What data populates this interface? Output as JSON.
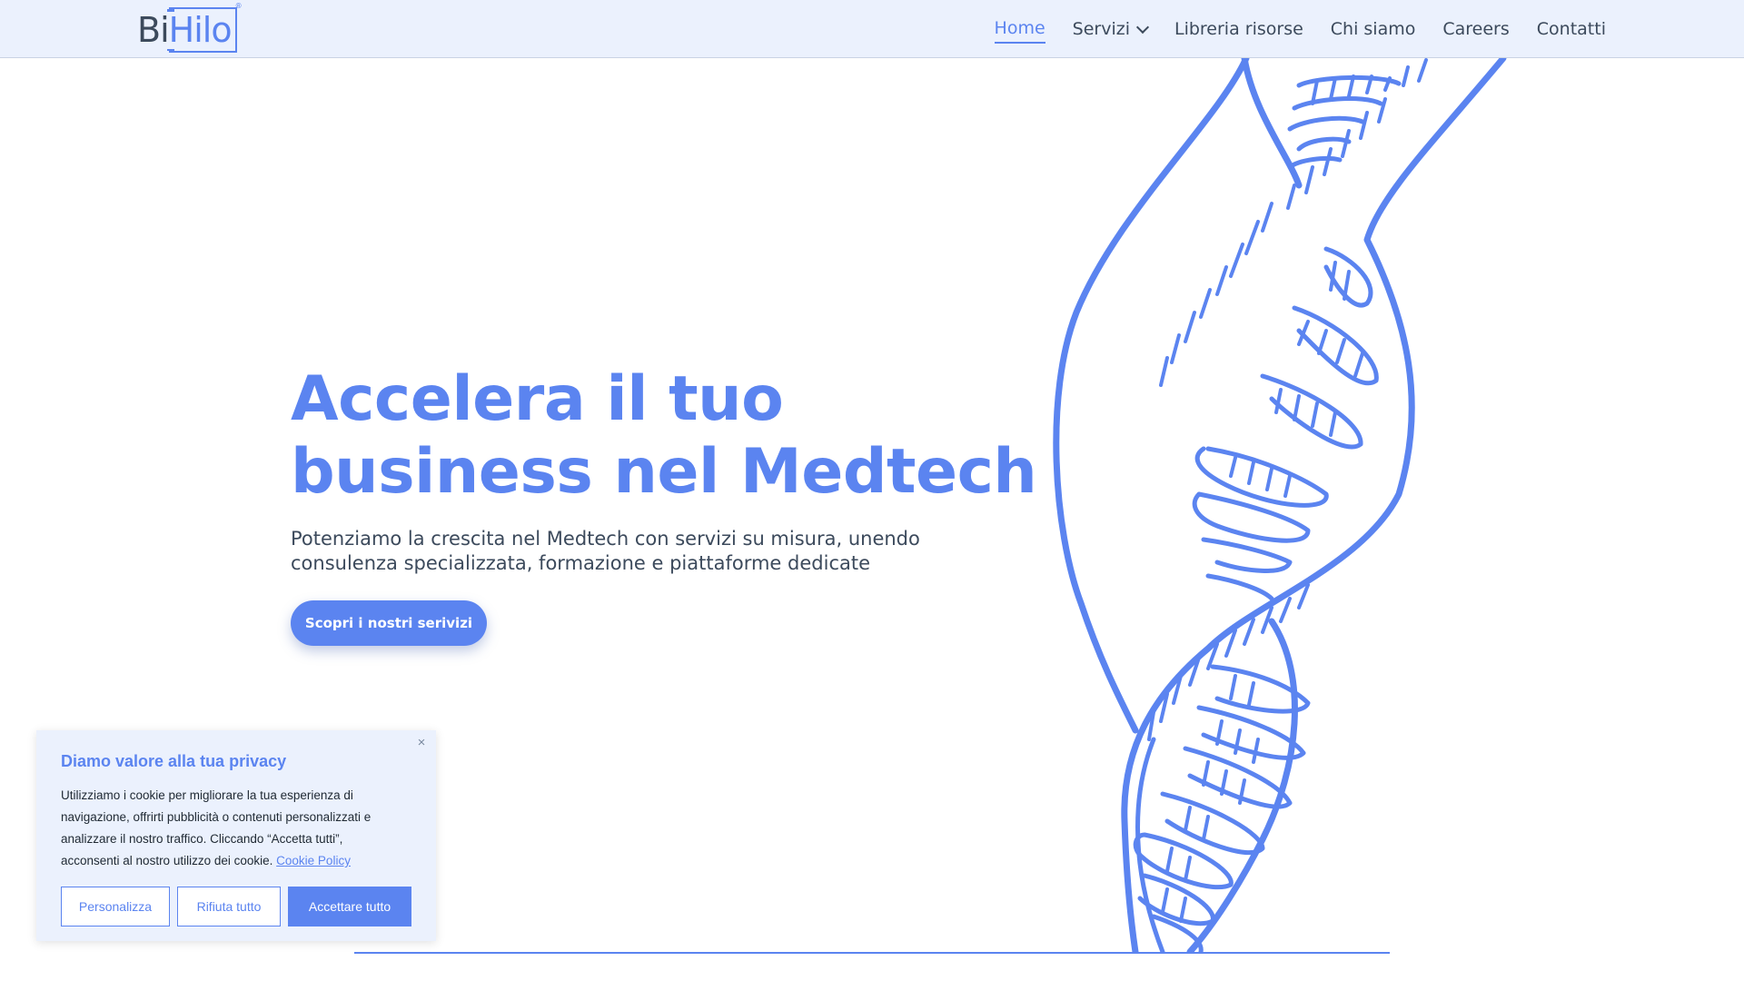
{
  "header": {
    "logo": {
      "part1": "Bi",
      "part2": "Hilo",
      "trademark": "®"
    },
    "nav": [
      {
        "label": "Home",
        "active": true
      },
      {
        "label": "Servizi",
        "has_dropdown": true
      },
      {
        "label": "Libreria risorse"
      },
      {
        "label": "Chi siamo"
      },
      {
        "label": "Careers"
      },
      {
        "label": "Contatti"
      }
    ]
  },
  "hero": {
    "title_line1": "Accelera il tuo",
    "title_line2": "business nel Medtech",
    "subtitle_line1": "Potenziamo la crescita nel Medtech con servizi su misura, unendo",
    "subtitle_line2": "consulenza specializzata, formazione e piattaforme dedicate",
    "cta_label": "Scopri i nostri serivizi",
    "illustration_icon": "dna-helix-icon"
  },
  "cookie_banner": {
    "title": "Diamo valore alla tua privacy",
    "body_line1": "Utilizziamo i cookie per migliorare la tua esperienza di",
    "body_line2": "navigazione, offrirti pubblicità o contenuti personalizzati e",
    "body_line3": "analizzare il nostro traffico. Cliccando “Accetta tutti”,",
    "body_line4": "acconsenti al nostro utilizzo dei cookie.",
    "policy_link": "Cookie Policy",
    "close_icon": "×",
    "buttons": {
      "customize": "Personalizza",
      "reject": "Rifiuta tutto",
      "accept": "Accettare tutto"
    }
  },
  "colors": {
    "accent": "#5b84f0",
    "header_bg": "#ebf1fd",
    "text": "#3c4a5c"
  }
}
